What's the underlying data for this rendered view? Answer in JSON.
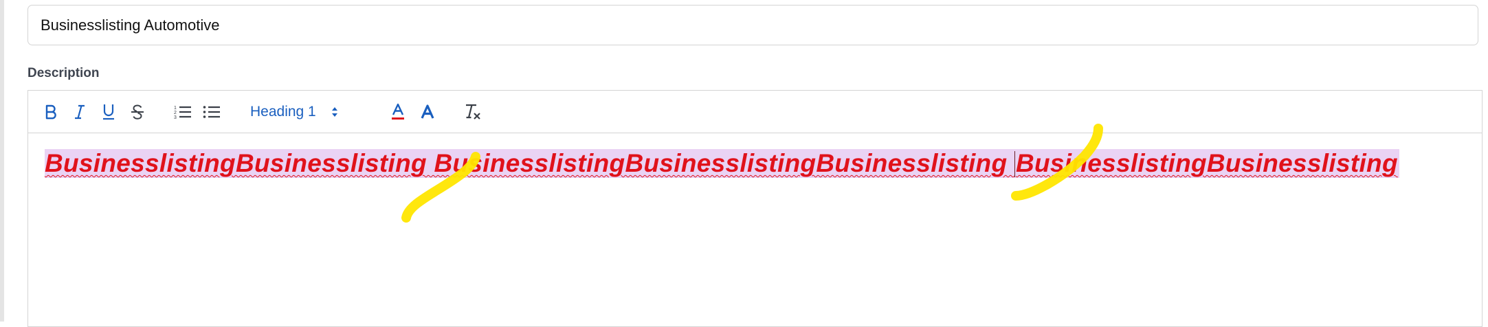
{
  "title_field": {
    "value": "Businesslisting Automotive"
  },
  "description": {
    "label": "Description"
  },
  "toolbar": {
    "buttons": [
      {
        "name": "bold-button",
        "icon": "bold-icon"
      },
      {
        "name": "italic-button",
        "icon": "italic-icon"
      },
      {
        "name": "underline-button",
        "icon": "underline-icon"
      },
      {
        "name": "strikethrough-button",
        "icon": "strikethrough-icon"
      },
      {
        "name": "ordered-list-button",
        "icon": "ordered-list-icon"
      },
      {
        "name": "bullet-list-button",
        "icon": "bullet-list-icon"
      },
      {
        "name": "font-color-button",
        "icon": "font-color-icon"
      },
      {
        "name": "highlight-color-button",
        "icon": "highlight-color-icon"
      },
      {
        "name": "clear-formatting-button",
        "icon": "clear-formatting-icon"
      }
    ],
    "heading_select": {
      "value": "Heading 1"
    },
    "accent_color": "#1a5fbf"
  },
  "editor": {
    "text_before_caret": "BusinesslistingBusinesslisting BusinesslistingBusinesslistingBusinesslisting ",
    "text_after_caret": "BusinesslistingBusinesslisting",
    "text_color": "#e0121b",
    "highlight_color": "#ead3f4"
  },
  "annotations": {
    "marker_color": "#ffe600"
  }
}
